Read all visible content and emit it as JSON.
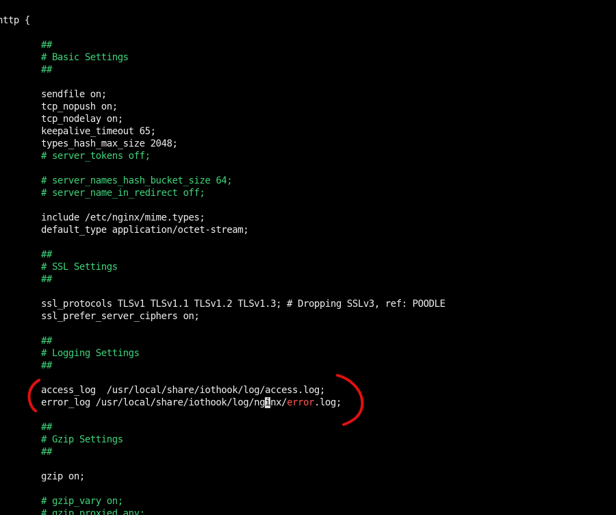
{
  "colors": {
    "background": "#000000",
    "text": "#ececec",
    "comment": "#3fd37a",
    "highlight_error": "#ff5353",
    "cursor": "#d8d8d8",
    "annotation": "#e01010"
  },
  "lines": [
    {
      "indent": 0,
      "segments": [
        {
          "text": "http {",
          "style": "plain"
        }
      ]
    },
    {
      "indent": 0,
      "segments": []
    },
    {
      "indent": 1,
      "segments": [
        {
          "text": "##",
          "style": "comment"
        }
      ]
    },
    {
      "indent": 1,
      "segments": [
        {
          "text": "# Basic Settings",
          "style": "comment"
        }
      ]
    },
    {
      "indent": 1,
      "segments": [
        {
          "text": "##",
          "style": "comment"
        }
      ]
    },
    {
      "indent": 0,
      "segments": []
    },
    {
      "indent": 1,
      "segments": [
        {
          "text": "sendfile on;",
          "style": "plain"
        }
      ]
    },
    {
      "indent": 1,
      "segments": [
        {
          "text": "tcp_nopush on;",
          "style": "plain"
        }
      ]
    },
    {
      "indent": 1,
      "segments": [
        {
          "text": "tcp_nodelay on;",
          "style": "plain"
        }
      ]
    },
    {
      "indent": 1,
      "segments": [
        {
          "text": "keepalive_timeout 65;",
          "style": "plain"
        }
      ]
    },
    {
      "indent": 1,
      "segments": [
        {
          "text": "types_hash_max_size 2048;",
          "style": "plain"
        }
      ]
    },
    {
      "indent": 1,
      "segments": [
        {
          "text": "# server_tokens off;",
          "style": "comment"
        }
      ]
    },
    {
      "indent": 0,
      "segments": []
    },
    {
      "indent": 1,
      "segments": [
        {
          "text": "# server_names_hash_bucket_size 64;",
          "style": "comment"
        }
      ]
    },
    {
      "indent": 1,
      "segments": [
        {
          "text": "# server_name_in_redirect off;",
          "style": "comment"
        }
      ]
    },
    {
      "indent": 0,
      "segments": []
    },
    {
      "indent": 1,
      "segments": [
        {
          "text": "include /etc/nginx/mime.types;",
          "style": "plain"
        }
      ]
    },
    {
      "indent": 1,
      "segments": [
        {
          "text": "default_type application/octet-stream;",
          "style": "plain"
        }
      ]
    },
    {
      "indent": 0,
      "segments": []
    },
    {
      "indent": 1,
      "segments": [
        {
          "text": "##",
          "style": "comment"
        }
      ]
    },
    {
      "indent": 1,
      "segments": [
        {
          "text": "# SSL Settings",
          "style": "comment"
        }
      ]
    },
    {
      "indent": 1,
      "segments": [
        {
          "text": "##",
          "style": "comment"
        }
      ]
    },
    {
      "indent": 0,
      "segments": []
    },
    {
      "indent": 1,
      "segments": [
        {
          "text": "ssl_protocols TLSv1 TLSv1.1 TLSv1.2 TLSv1.3; # Dropping SSLv3, ref: POODLE",
          "style": "plain"
        }
      ]
    },
    {
      "indent": 1,
      "segments": [
        {
          "text": "ssl_prefer_server_ciphers on;",
          "style": "plain"
        }
      ]
    },
    {
      "indent": 0,
      "segments": []
    },
    {
      "indent": 1,
      "segments": [
        {
          "text": "##",
          "style": "comment"
        }
      ]
    },
    {
      "indent": 1,
      "segments": [
        {
          "text": "# Logging Settings",
          "style": "comment"
        }
      ]
    },
    {
      "indent": 1,
      "segments": [
        {
          "text": "##",
          "style": "comment"
        }
      ]
    },
    {
      "indent": 0,
      "segments": []
    },
    {
      "indent": 1,
      "segments": [
        {
          "text": "access_log  /usr/local/share/iothook/log/access.log;",
          "style": "plain"
        }
      ]
    },
    {
      "indent": 1,
      "segments": [
        {
          "text": "error_log /usr/local/share/iothook/log/ng",
          "style": "plain"
        },
        {
          "text": "i",
          "style": "cursor"
        },
        {
          "text": "nx/",
          "style": "plain"
        },
        {
          "text": "error",
          "style": "err"
        },
        {
          "text": ".log;",
          "style": "plain"
        }
      ]
    },
    {
      "indent": 0,
      "segments": []
    },
    {
      "indent": 1,
      "segments": [
        {
          "text": "##",
          "style": "comment"
        }
      ]
    },
    {
      "indent": 1,
      "segments": [
        {
          "text": "# Gzip Settings",
          "style": "comment"
        }
      ]
    },
    {
      "indent": 1,
      "segments": [
        {
          "text": "##",
          "style": "comment"
        }
      ]
    },
    {
      "indent": 0,
      "segments": []
    },
    {
      "indent": 1,
      "segments": [
        {
          "text": "gzip on;",
          "style": "plain"
        }
      ]
    },
    {
      "indent": 0,
      "segments": []
    },
    {
      "indent": 1,
      "segments": [
        {
          "text": "# gzip_vary on;",
          "style": "comment"
        }
      ]
    },
    {
      "indent": 1,
      "segments": [
        {
          "text": "# gzip_proxied any;",
          "style": "comment"
        }
      ]
    }
  ]
}
